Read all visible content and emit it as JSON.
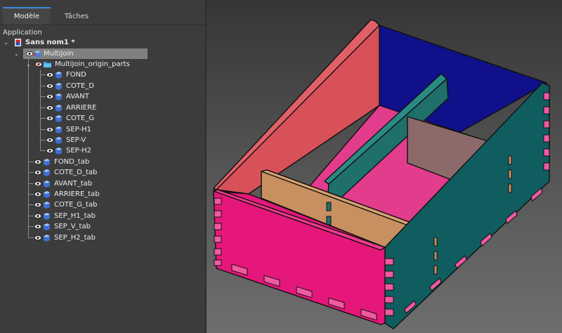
{
  "tabs": [
    {
      "label": "Modèle",
      "active": true
    },
    {
      "label": "Tâches",
      "active": false
    }
  ],
  "section_label": "Application",
  "tree": {
    "document": "Sans nom1 *",
    "root": "MultiJoin",
    "origin_group": "MultiJoin_origin_parts",
    "origin_parts": [
      "FOND",
      "COTE_D",
      "AVANT",
      "ARRIERE",
      "COTE_G",
      "SEP-H1",
      "SEP-V",
      "SEP-H2"
    ],
    "tabs_parts": [
      "FOND_tab",
      "COTE_D_tab",
      "AVANT_tab",
      "ARRIERE_tab",
      "COTE_G_tab",
      "SEP_H1_tab",
      "SEP_V_tab",
      "SEP_H2_tab"
    ]
  },
  "colors": {
    "accent": "#3b8be0",
    "selection": "#808080",
    "front_face": "#e5177a",
    "left_panel": "#d85058",
    "back_panel": "#10108a",
    "right_panel": "#0f5d5f",
    "floor": "#e23c8c",
    "divider_long": "#1f6f6a",
    "divider_tan": "#c89060",
    "divider_mauve": "#8c6a6a"
  },
  "icons": {
    "document": "document-icon",
    "visibility": "eye-icon",
    "part": "cube-icon",
    "group": "folder-icon"
  }
}
